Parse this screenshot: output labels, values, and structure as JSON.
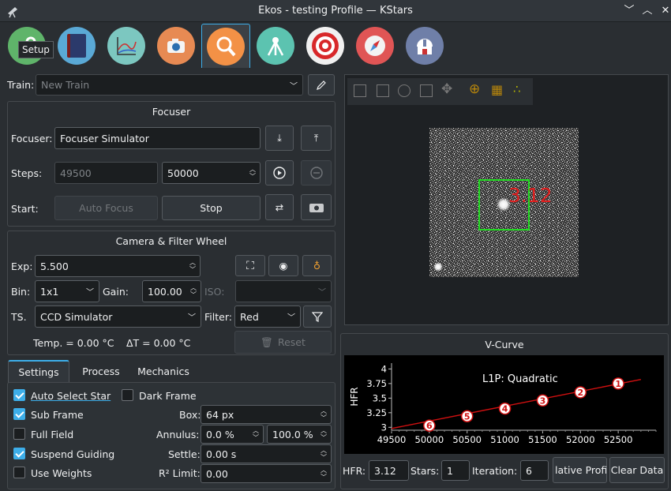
{
  "window": {
    "title": "Ekos - testing Profile — KStars"
  },
  "tooltip": "Setup",
  "modules": [
    "setup",
    "scheduler",
    "analyze",
    "capture",
    "focus",
    "mount",
    "align",
    "guide",
    "observatory"
  ],
  "train": {
    "label": "Train:",
    "value": "New Train"
  },
  "focuser": {
    "title": "Focuser",
    "focuser_label": "Focuser:",
    "focuser_value": "Focuser Simulator",
    "steps_label": "Steps:",
    "steps_current": "49500",
    "steps_target": "50000",
    "start_label": "Start:",
    "auto_focus": "Auto Focus",
    "stop": "Stop"
  },
  "camera": {
    "title": "Camera & Filter Wheel",
    "exp_label": "Exp:",
    "exp_value": "5.500",
    "bin_label": "Bin:",
    "bin_value": "1x1",
    "gain_label": "Gain:",
    "gain_value": "100.00",
    "iso_label": "ISO:",
    "ts_label": "TS.",
    "ts_value": "CCD Simulator",
    "filter_label": "Filter:",
    "filter_value": "Red",
    "temp": "Temp. = 0.00 °C",
    "delta_t": "ΔT = 0.00 °C",
    "reset": "Reset"
  },
  "tabs": [
    "Settings",
    "Process",
    "Mechanics"
  ],
  "settings": {
    "auto_select_star": "Auto Select Star",
    "dark_frame": "Dark Frame",
    "sub_frame": "Sub Frame",
    "full_field": "Full Field",
    "suspend_guiding": "Suspend Guiding",
    "use_weights": "Use Weights",
    "box_label": "Box:",
    "box_value": "64 px",
    "annulus_label": "Annulus:",
    "annulus_min": "0.0 %",
    "annulus_max": "100.0 %",
    "settle_label": "Settle:",
    "settle_value": "0.00 s",
    "r2_label": "R² Limit:",
    "r2_value": "0.00"
  },
  "star_readout": "3.12",
  "vcurve": {
    "title": "V-Curve",
    "hfr_label": "HFR:",
    "hfr_value": "3.12",
    "stars_label": "Stars:",
    "stars_value": "1",
    "iteration_label": "Iteration:",
    "iteration_value": "6",
    "relative_profile": "lative Profile",
    "clear_data": "Clear Data"
  },
  "chart_data": {
    "type": "scatter",
    "title": "",
    "annotation": "L1P: Quadratic",
    "xlabel": "",
    "ylabel": "HFR",
    "xlim": [
      49500,
      53000
    ],
    "ylim": [
      2.95,
      4.1
    ],
    "x_ticks": [
      "49500",
      "50000",
      "50500",
      "51000",
      "51500",
      "52000",
      "52500"
    ],
    "y_ticks": [
      "3",
      "3.25",
      "3.5",
      "3.75",
      "4"
    ],
    "points": [
      {
        "label": "1",
        "x": 52500,
        "y": 3.75
      },
      {
        "label": "2",
        "x": 52000,
        "y": 3.6
      },
      {
        "label": "3",
        "x": 51500,
        "y": 3.46
      },
      {
        "label": "4",
        "x": 51000,
        "y": 3.32
      },
      {
        "label": "5",
        "x": 50500,
        "y": 3.19
      },
      {
        "label": "6",
        "x": 50000,
        "y": 3.03
      }
    ],
    "fit_line": {
      "x": [
        49500,
        52800
      ],
      "y": [
        2.98,
        3.82
      ]
    },
    "colors": {
      "line": "#d01010",
      "point_fill": "#ffffff",
      "point_edge": "#d01010"
    }
  }
}
